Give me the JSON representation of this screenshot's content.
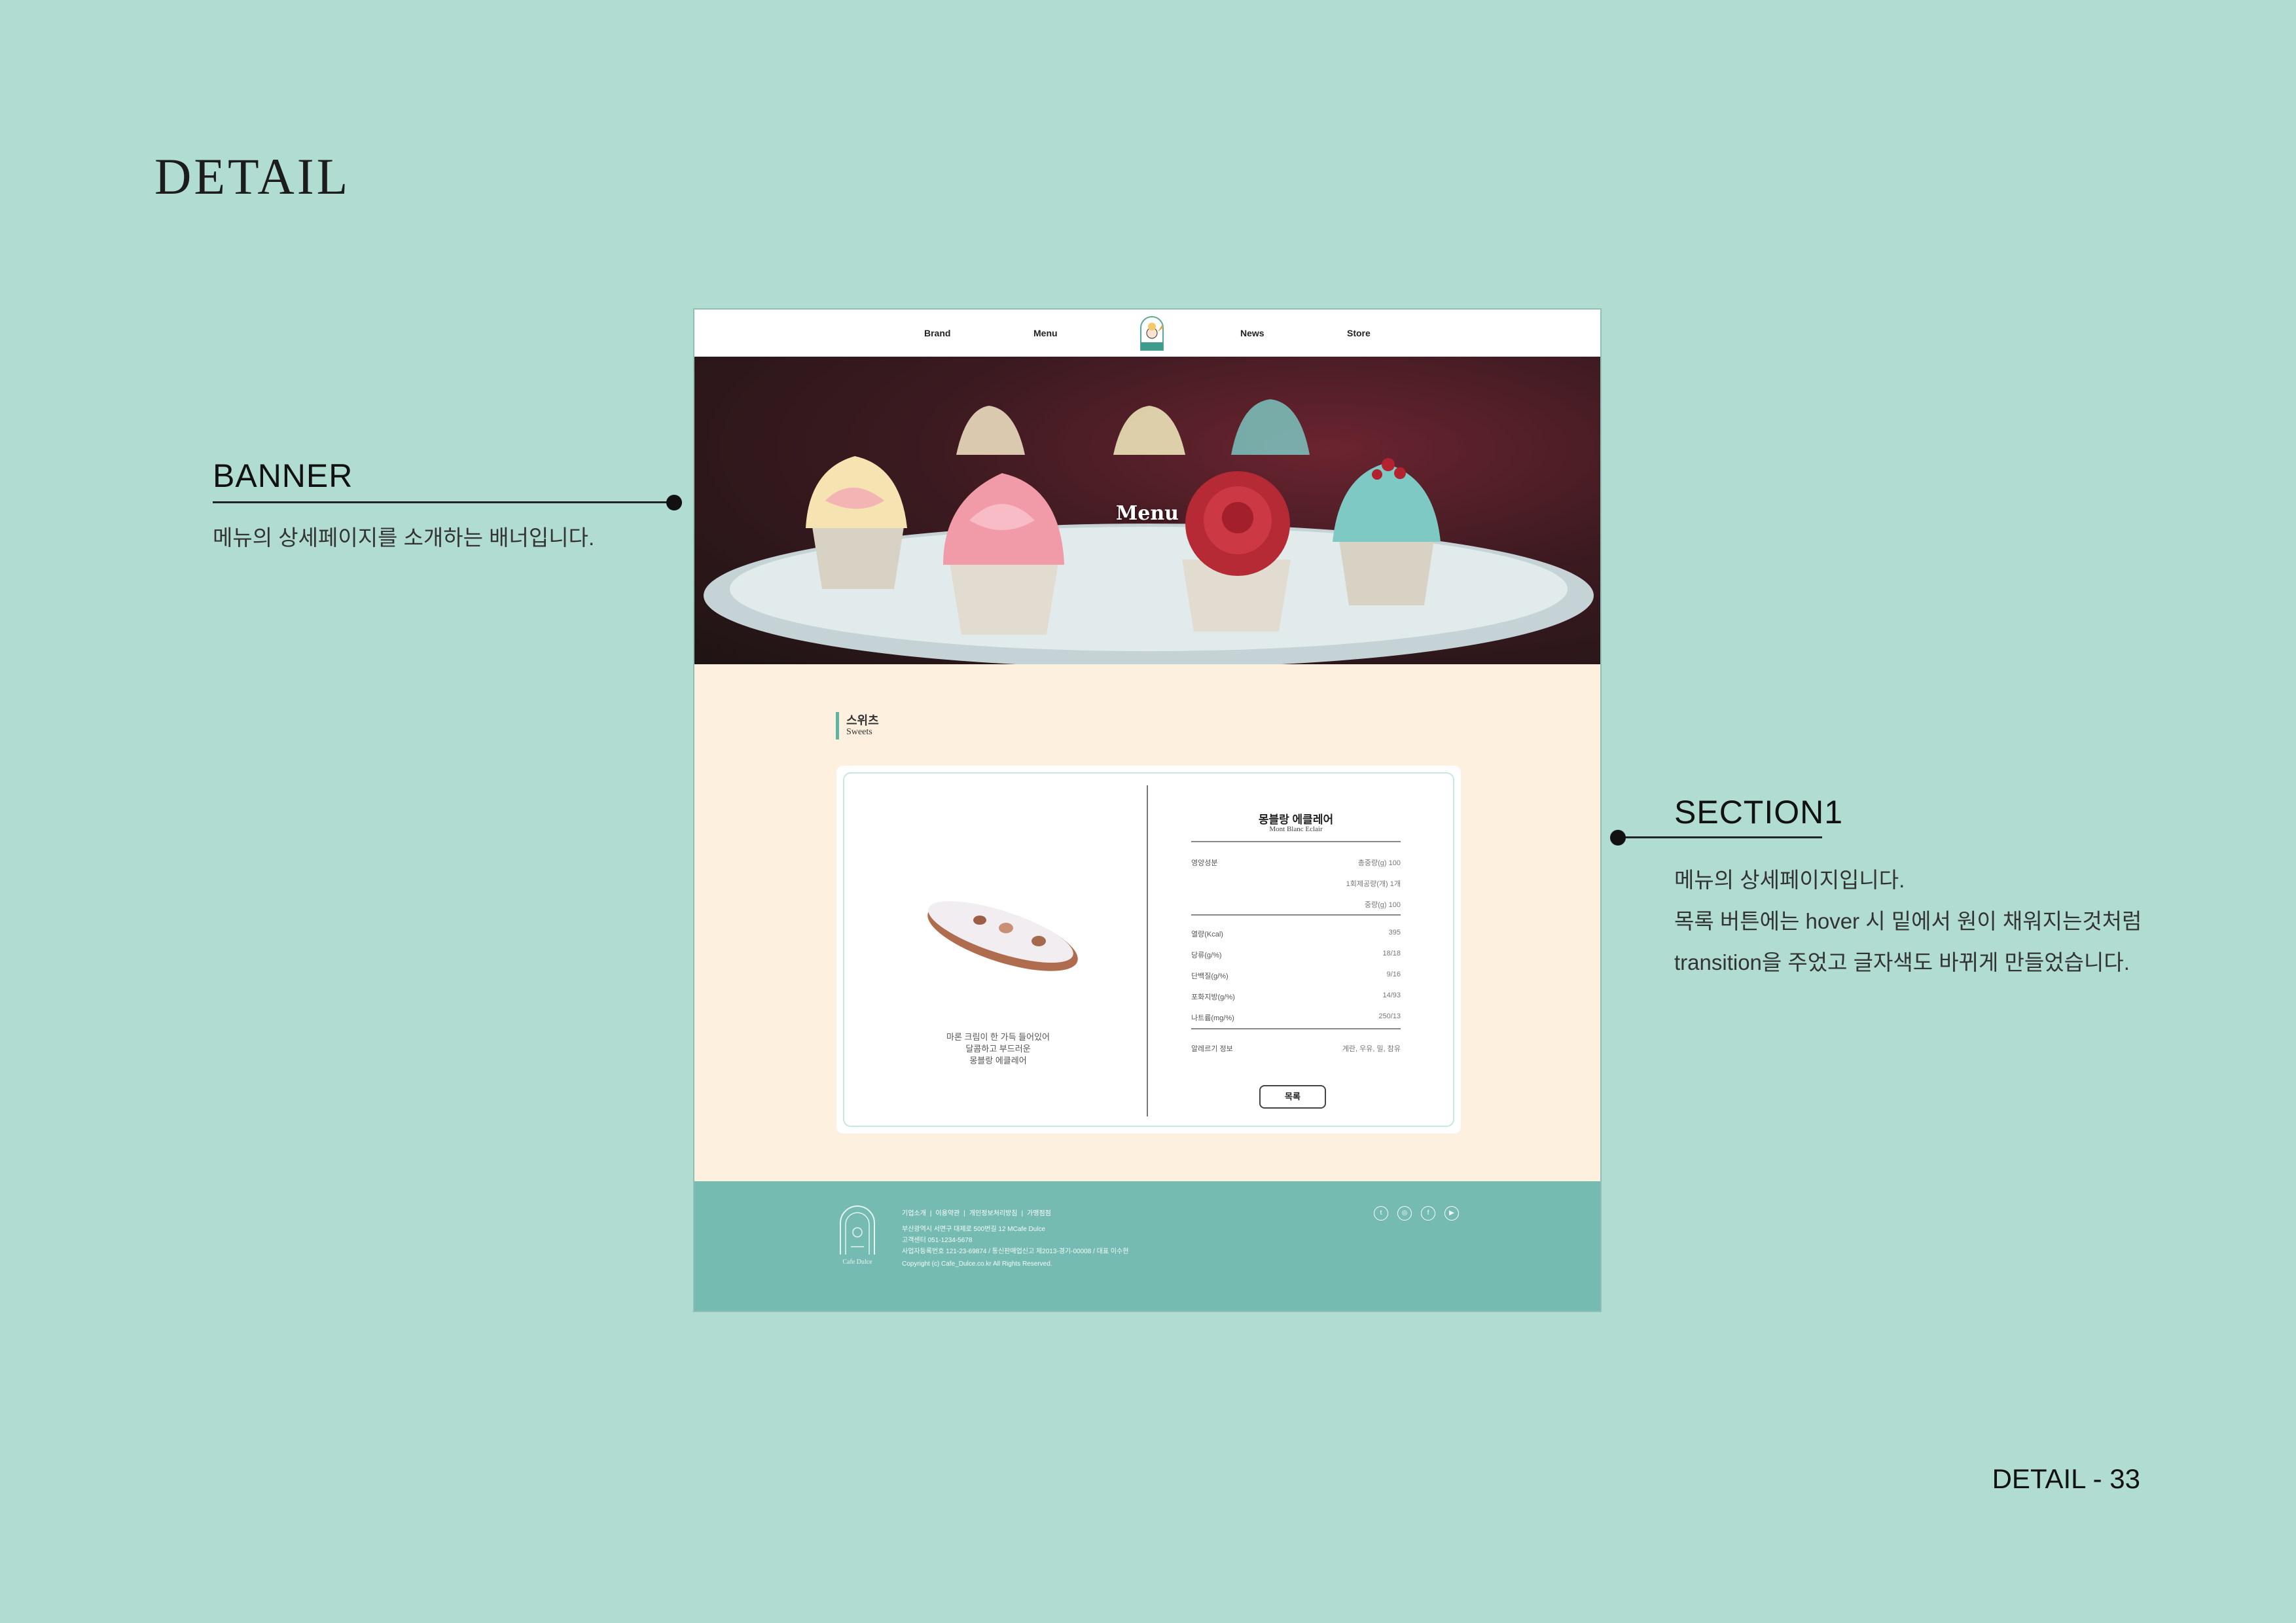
{
  "slide": {
    "title": "DETAIL",
    "page_label": "DETAIL - 33",
    "banner_note": {
      "title": "BANNER",
      "text": "메뉴의 상세페이지를 소개하는 배너입니다."
    },
    "section_note": {
      "title": "SECTION1",
      "lines": [
        "메뉴의 상세페이지입니다.",
        "목록 버튼에는 hover 시 밑에서 원이 채워지는것처럼",
        "transition을 주었고 글자색도 바뀌게 만들었습니다."
      ]
    }
  },
  "nav": {
    "items": [
      "Brand",
      "Menu",
      "News",
      "Store"
    ]
  },
  "banner": {
    "title": "Menu"
  },
  "category": {
    "ko": "스위츠",
    "en": "Sweets"
  },
  "product": {
    "title": "몽블랑 에클레어",
    "subtitle": "Mont Blanc Eclair",
    "description": [
      "마론 크림이 한 가득 들어있어",
      "달콤하고 부드러운",
      "몽블랑 에클레어"
    ],
    "info": [
      {
        "k": "영양성분",
        "v": "총중량(g) 100"
      },
      {
        "k": "",
        "v": "1회제공량(개) 1개"
      },
      {
        "k": "",
        "v": "중량(g) 100"
      }
    ],
    "nutrition": [
      {
        "k": "열량(Kcal)",
        "v": "395"
      },
      {
        "k": "당류(g/%)",
        "v": "18/18"
      },
      {
        "k": "단백질(g/%)",
        "v": "9/16"
      },
      {
        "k": "포화지방(g/%)",
        "v": "14/93"
      },
      {
        "k": "나트륨(mg/%)",
        "v": "250/13"
      }
    ],
    "allergy": {
      "k": "알레르기 정보",
      "v": "계란, 우유, 밀, 참유"
    },
    "list_button": "목록"
  },
  "footer": {
    "logo_text": "Cafe Dulce",
    "links": [
      "기업소개",
      "이용약관",
      "개인정보처리방침",
      "가맹점점"
    ],
    "lines": [
      "부산광역시 서면구 대제로 500번길 12 MCafe Dulce",
      "고객센터 051-1234-5678",
      "사업자등록번호 121-23-69874 / 통신판매업신고 제2013-경기-00008 / 대표 이수현",
      "Copyright (c) Cafe_Dulce.co.kr All Rights Reserved."
    ],
    "sns": [
      "twitter-icon",
      "instagram-icon",
      "facebook-icon",
      "youtube-icon"
    ]
  }
}
